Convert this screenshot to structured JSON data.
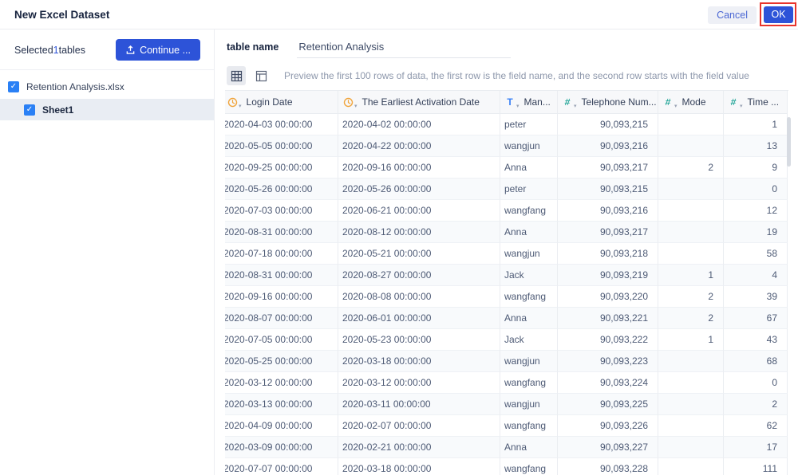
{
  "dialog": {
    "title": "New Excel Dataset",
    "cancel_label": "Cancel",
    "ok_label": "OK",
    "annotation_color": "#e8342c"
  },
  "sidebar": {
    "selected_prefix": "Selected",
    "selected_count": "1",
    "selected_suffix": "tables",
    "continue_label": "Continue ...",
    "file": {
      "name": "Retention Analysis.xlsx",
      "checked": true
    },
    "sheet": {
      "name": "Sheet1",
      "checked": true
    },
    "check_glyph": "✓"
  },
  "main": {
    "table_name_label": "table name",
    "table_name_value": "Retention Analysis",
    "preview_note": "Preview the first 100 rows of data, the first row is the field name, and the second row starts with the field value"
  },
  "preview_table": {
    "columns": [
      {
        "label": "Login Date",
        "type": "date",
        "icon": "clock-icon",
        "align": "left"
      },
      {
        "label": "The Earliest Activation Date",
        "type": "date",
        "icon": "clock-icon",
        "align": "left"
      },
      {
        "label": "Man...",
        "type": "string",
        "icon": "text-icon",
        "align": "left"
      },
      {
        "label": "Telephone Num...",
        "type": "number",
        "icon": "number-icon",
        "align": "right"
      },
      {
        "label": "Mode",
        "type": "number",
        "icon": "number-icon",
        "align": "right"
      },
      {
        "label": "Time ...",
        "type": "number",
        "icon": "number-icon",
        "align": "right"
      }
    ],
    "rows": [
      [
        "2020-04-03 00:00:00",
        "2020-04-02 00:00:00",
        "peter",
        "90,093,215",
        "",
        "1"
      ],
      [
        "2020-05-05 00:00:00",
        "2020-04-22 00:00:00",
        "wangjun",
        "90,093,216",
        "",
        "13"
      ],
      [
        "2020-09-25 00:00:00",
        "2020-09-16 00:00:00",
        "Anna",
        "90,093,217",
        "2",
        "9"
      ],
      [
        "2020-05-26 00:00:00",
        "2020-05-26 00:00:00",
        "peter",
        "90,093,215",
        "",
        "0"
      ],
      [
        "2020-07-03 00:00:00",
        "2020-06-21 00:00:00",
        "wangfang",
        "90,093,216",
        "",
        "12"
      ],
      [
        "2020-08-31 00:00:00",
        "2020-08-12 00:00:00",
        "Anna",
        "90,093,217",
        "",
        "19"
      ],
      [
        "2020-07-18 00:00:00",
        "2020-05-21 00:00:00",
        "wangjun",
        "90,093,218",
        "",
        "58"
      ],
      [
        "2020-08-31 00:00:00",
        "2020-08-27 00:00:00",
        "Jack",
        "90,093,219",
        "1",
        "4"
      ],
      [
        "2020-09-16 00:00:00",
        "2020-08-08 00:00:00",
        "wangfang",
        "90,093,220",
        "2",
        "39"
      ],
      [
        "2020-08-07 00:00:00",
        "2020-06-01 00:00:00",
        "Anna",
        "90,093,221",
        "2",
        "67"
      ],
      [
        "2020-07-05 00:00:00",
        "2020-05-23 00:00:00",
        "Jack",
        "90,093,222",
        "1",
        "43"
      ],
      [
        "2020-05-25 00:00:00",
        "2020-03-18 00:00:00",
        "wangjun",
        "90,093,223",
        "",
        "68"
      ],
      [
        "2020-03-12 00:00:00",
        "2020-03-12 00:00:00",
        "wangfang",
        "90,093,224",
        "",
        "0"
      ],
      [
        "2020-03-13 00:00:00",
        "2020-03-11 00:00:00",
        "wangjun",
        "90,093,225",
        "",
        "2"
      ],
      [
        "2020-04-09 00:00:00",
        "2020-02-07 00:00:00",
        "wangfang",
        "90,093,226",
        "",
        "62"
      ],
      [
        "2020-03-09 00:00:00",
        "2020-02-21 00:00:00",
        "Anna",
        "90,093,227",
        "",
        "17"
      ],
      [
        "2020-07-07 00:00:00",
        "2020-03-18 00:00:00",
        "wangfang",
        "90,093,228",
        "",
        "111"
      ]
    ]
  },
  "colors": {
    "accent_blue": "#2d53d8",
    "checkbox_blue": "#2a80f5",
    "clock_icon_color": "#f0a43b",
    "text_icon_color": "#3b82f6",
    "number_icon_color": "#27a79a"
  }
}
